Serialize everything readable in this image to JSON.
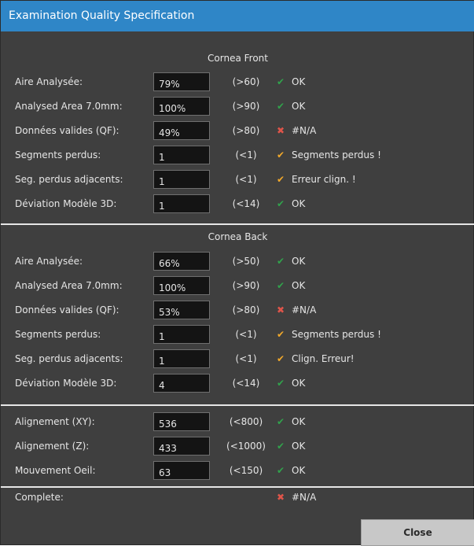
{
  "window": {
    "title": "Examination Quality Specification"
  },
  "colors": {
    "titlebar": "#2f86c7",
    "ok": "#31a24c",
    "error": "#e0554a",
    "warning": "#f2a92b"
  },
  "sections": [
    {
      "title": "Cornea Front",
      "rows": [
        {
          "label": "Aire Analysée:",
          "value": "79%",
          "range": "(>60)",
          "icon": "check-icon",
          "mark": "✔",
          "status": "OK"
        },
        {
          "label": "Analysed Area 7.0mm:",
          "value": "100%",
          "range": "(>90)",
          "icon": "check-icon",
          "mark": "✔",
          "status": "OK"
        },
        {
          "label": "Données valides (QF):",
          "value": "49%",
          "range": "(>80)",
          "icon": "cross-icon",
          "mark": "✖",
          "status": "#N/A"
        },
        {
          "label": "Segments perdus:",
          "value": "1",
          "range": "(<1)",
          "icon": "warning-check-icon",
          "mark": "✔",
          "status": "Segments perdus !"
        },
        {
          "label": "Seg. perdus adjacents:",
          "value": "1",
          "range": "(<1)",
          "icon": "warning-check-icon",
          "mark": "✔",
          "status": "Erreur clign. !"
        },
        {
          "label": "Déviation Modèle 3D:",
          "value": "1",
          "range": "(<14)",
          "icon": "check-icon",
          "mark": "✔",
          "status": "OK"
        }
      ]
    },
    {
      "title": "Cornea Back",
      "rows": [
        {
          "label": "Aire Analysée:",
          "value": "66%",
          "range": "(>50)",
          "icon": "check-icon",
          "mark": "✔",
          "status": "OK"
        },
        {
          "label": "Analysed Area 7.0mm:",
          "value": "100%",
          "range": "(>90)",
          "icon": "check-icon",
          "mark": "✔",
          "status": "OK"
        },
        {
          "label": "Données valides (QF):",
          "value": "53%",
          "range": "(>80)",
          "icon": "cross-icon",
          "mark": "✖",
          "status": "#N/A"
        },
        {
          "label": "Segments perdus:",
          "value": "1",
          "range": "(<1)",
          "icon": "warning-check-icon",
          "mark": "✔",
          "status": "Segments perdus !"
        },
        {
          "label": "Seg. perdus adjacents:",
          "value": "1",
          "range": "(<1)",
          "icon": "warning-check-icon",
          "mark": "✔",
          "status": "Clign. Erreur!"
        },
        {
          "label": "Déviation Modèle 3D:",
          "value": "4",
          "range": "(<14)",
          "icon": "check-icon",
          "mark": "✔",
          "status": "OK"
        }
      ]
    },
    {
      "title": "",
      "rows": [
        {
          "label": "Alignement (XY):",
          "value": "536",
          "range": "(<800)",
          "icon": "check-icon",
          "mark": "✔",
          "status": "OK"
        },
        {
          "label": "Alignement (Z):",
          "value": "433",
          "range": "(<1000)",
          "icon": "check-icon",
          "mark": "✔",
          "status": "OK"
        },
        {
          "label": "Mouvement Oeil:",
          "value": "63",
          "range": "(<150)",
          "icon": "check-icon",
          "mark": "✔",
          "status": "OK"
        }
      ]
    }
  ],
  "complete": {
    "label": "Complete:",
    "icon": "cross-icon",
    "mark": "✖",
    "status": "#N/A"
  },
  "close_button": {
    "label": "Close"
  }
}
